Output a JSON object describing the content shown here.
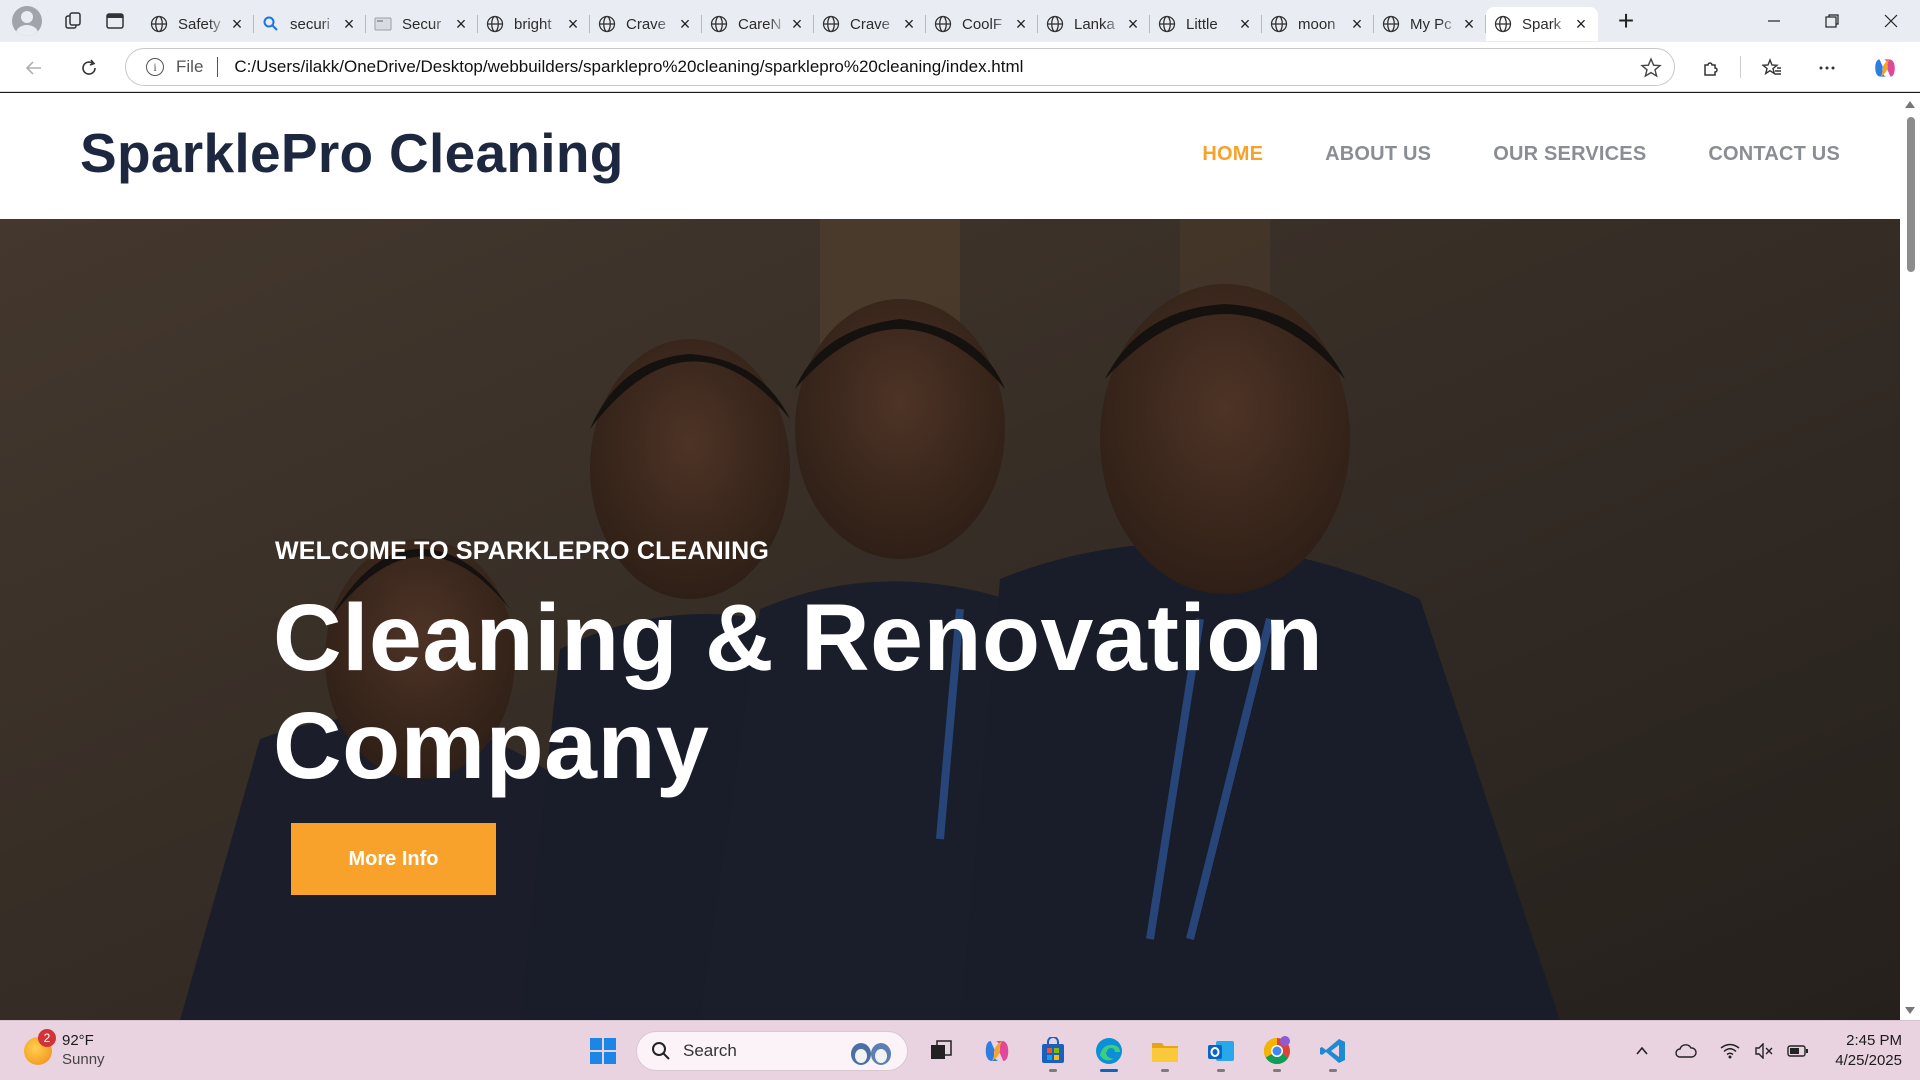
{
  "browser": {
    "tabs": [
      {
        "title": "Safety",
        "favicon": "globe"
      },
      {
        "title": "securi",
        "favicon": "search"
      },
      {
        "title": "Secur",
        "favicon": "page"
      },
      {
        "title": "bright",
        "favicon": "globe"
      },
      {
        "title": "Crave",
        "favicon": "globe"
      },
      {
        "title": "CareN",
        "favicon": "globe"
      },
      {
        "title": "Crave",
        "favicon": "globe"
      },
      {
        "title": "CoolF",
        "favicon": "globe"
      },
      {
        "title": "Lanka",
        "favicon": "globe"
      },
      {
        "title": "Little",
        "favicon": "globe"
      },
      {
        "title": "moon",
        "favicon": "globe"
      },
      {
        "title": "My Pc",
        "favicon": "globe"
      },
      {
        "title": "Spark",
        "favicon": "globe",
        "active": true
      }
    ],
    "address": {
      "scheme_label": "File",
      "url": "C:/Users/ilakk/OneDrive/Desktop/webbuilders/sparklepro%20cleaning/sparklepro%20cleaning/index.html"
    }
  },
  "site": {
    "brand": "SparklePro Cleaning",
    "nav": [
      {
        "label": "HOME",
        "active": true
      },
      {
        "label": "ABOUT US"
      },
      {
        "label": "OUR SERVICES"
      },
      {
        "label": "CONTACT US"
      }
    ],
    "hero": {
      "subtitle": "WELCOME TO SPARKLEPRO CLEANING",
      "title": "Cleaning & Renovation Company",
      "button_label": "More Info"
    },
    "colors": {
      "accent": "#f8a12b",
      "brand_text": "#1d2740",
      "nav_text": "#8a8d93"
    }
  },
  "taskbar": {
    "weather": {
      "temp": "92°F",
      "condition": "Sunny",
      "badge": "2"
    },
    "search_placeholder": "Search",
    "clock": {
      "time": "2:45 PM",
      "date": "4/25/2025"
    },
    "pinned": [
      "task-view-icon",
      "copilot-icon",
      "store-icon",
      "edge-icon",
      "file-explorer-icon",
      "outlook-icon",
      "chrome-icon",
      "vscode-icon"
    ]
  }
}
